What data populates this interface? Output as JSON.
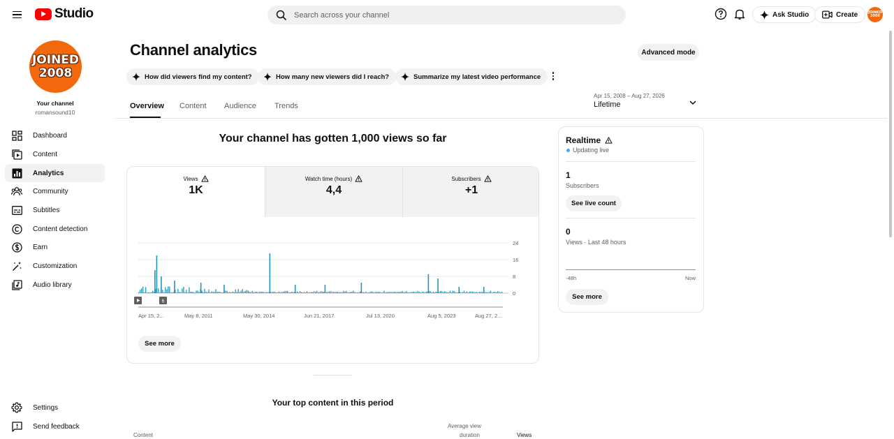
{
  "header": {
    "logo_text": "Studio",
    "search_placeholder": "Search across your channel",
    "ask_studio_label": "Ask Studio",
    "create_label": "Create",
    "avatar_text": "JOINED 2008"
  },
  "sidebar": {
    "avatar_line1": "JOINED",
    "avatar_line2": "2008",
    "your_channel": "Your channel",
    "handle": "romansound10",
    "items": [
      {
        "label": "Dashboard",
        "icon": "dashboard-icon"
      },
      {
        "label": "Content",
        "icon": "content-icon"
      },
      {
        "label": "Analytics",
        "icon": "analytics-icon",
        "active": true
      },
      {
        "label": "Community",
        "icon": "community-icon"
      },
      {
        "label": "Subtitles",
        "icon": "subtitles-icon"
      },
      {
        "label": "Content detection",
        "icon": "copyright-icon"
      },
      {
        "label": "Earn",
        "icon": "earn-icon"
      },
      {
        "label": "Customization",
        "icon": "customization-icon"
      },
      {
        "label": "Audio library",
        "icon": "audio-library-icon"
      }
    ],
    "settings_label": "Settings",
    "feedback_label": "Send feedback"
  },
  "main": {
    "title": "Channel analytics",
    "advanced_mode_label": "Advanced mode",
    "chips": [
      "How did viewers find my content?",
      "How many new viewers did I reach?",
      "Summarize my latest video performance"
    ],
    "tabs": [
      "Overview",
      "Content",
      "Audience",
      "Trends"
    ],
    "active_tab": "Overview",
    "date_range": "Apr 15, 2008 – Aug 27, 2026",
    "date_label": "Lifetime",
    "headline": "Your channel has gotten 1,000 views so far",
    "metrics": [
      {
        "label": "Views",
        "value": "1K"
      },
      {
        "label": "Watch time (hours)",
        "value": "4,4"
      },
      {
        "label": "Subscribers",
        "value": "+1"
      }
    ],
    "see_more_label": "See more",
    "top_content_title": "Your top content in this period",
    "table_headers": {
      "content": "Content",
      "avg_view_1": "Average view",
      "avg_view_2": "duration",
      "views": "Views"
    }
  },
  "realtime": {
    "title": "Realtime",
    "status": "Updating live",
    "subscribers_value": "1",
    "subscribers_label": "Subscribers",
    "see_live_count_label": "See live count",
    "views_value": "0",
    "views_label": "Views · Last 48 hours",
    "axis_start": "-48h",
    "axis_end": "Now",
    "see_more_label": "See more"
  },
  "chart_data": {
    "type": "bar",
    "y_ticks": [
      "24",
      "16",
      "8",
      "0"
    ],
    "ylim": [
      0,
      24
    ],
    "x_tick_labels": [
      "Apr 15, 2...",
      "May 8, 2011",
      "May 30, 2014",
      "Jun 21, 2017",
      "Jul 13, 2020",
      "Aug 5, 2023",
      "Aug 27, 2..."
    ],
    "marker_label": "6",
    "series": [
      {
        "color": "#2596be",
        "x_start": "2008-04-15",
        "x_end": "2026-08-27",
        "peaks": [
          {
            "date": "2009-03-10",
            "value": 18
          },
          {
            "date": "2009-02-05",
            "value": 11
          },
          {
            "date": "2009-06-01",
            "value": 8
          },
          {
            "date": "2014-11-20",
            "value": 19
          },
          {
            "date": "2010-02-01",
            "value": 6
          },
          {
            "date": "2011-06-01",
            "value": 5
          },
          {
            "date": "2012-08-01",
            "value": 4
          },
          {
            "date": "2016-03-01",
            "value": 4
          },
          {
            "date": "2017-09-01",
            "value": 4
          },
          {
            "date": "2019-07-01",
            "value": 5
          },
          {
            "date": "2022-11-15",
            "value": 9
          },
          {
            "date": "2023-05-10",
            "value": 7
          },
          {
            "date": "2024-06-01",
            "value": 3
          },
          {
            "date": "2025-09-01",
            "value": 3
          }
        ],
        "baseline": 1
      }
    ]
  }
}
